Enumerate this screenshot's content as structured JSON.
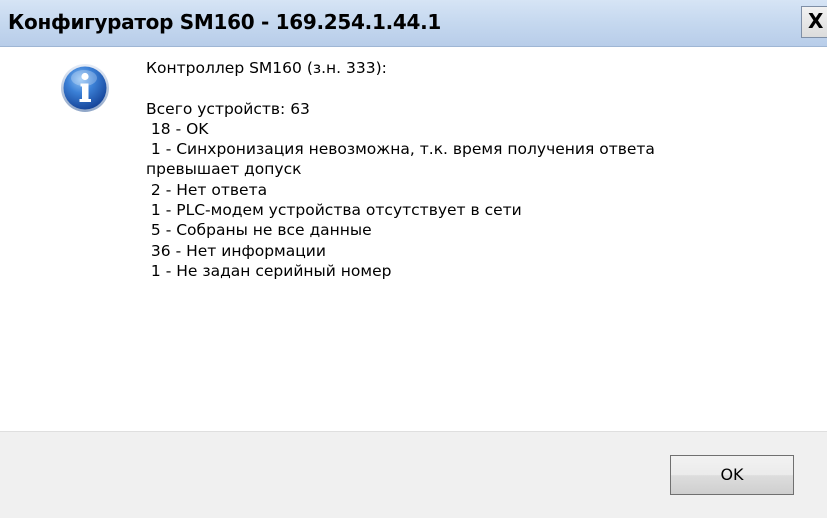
{
  "window": {
    "title": "Конфигуратор SM160 - 169.254.1.44.1",
    "close_glyph": "X"
  },
  "icon": {
    "name": "info-icon",
    "glyph": "i"
  },
  "message": {
    "header": "Контроллер SM160 (з.н. 333):",
    "total": "Всего устройств: 63",
    "status_lines": [
      " 18 - OK",
      " 1 - Синхронизация невозможна, т.к. время получения ответа",
      "превышает допуск",
      " 2 - Нет ответа",
      " 1 - PLC-модем устройства отсутствует в сети",
      " 5 - Собраны не все данные",
      " 36 - Нет информации",
      " 1 - Не задан серийный номер"
    ]
  },
  "buttons": {
    "ok_label": "OK"
  }
}
